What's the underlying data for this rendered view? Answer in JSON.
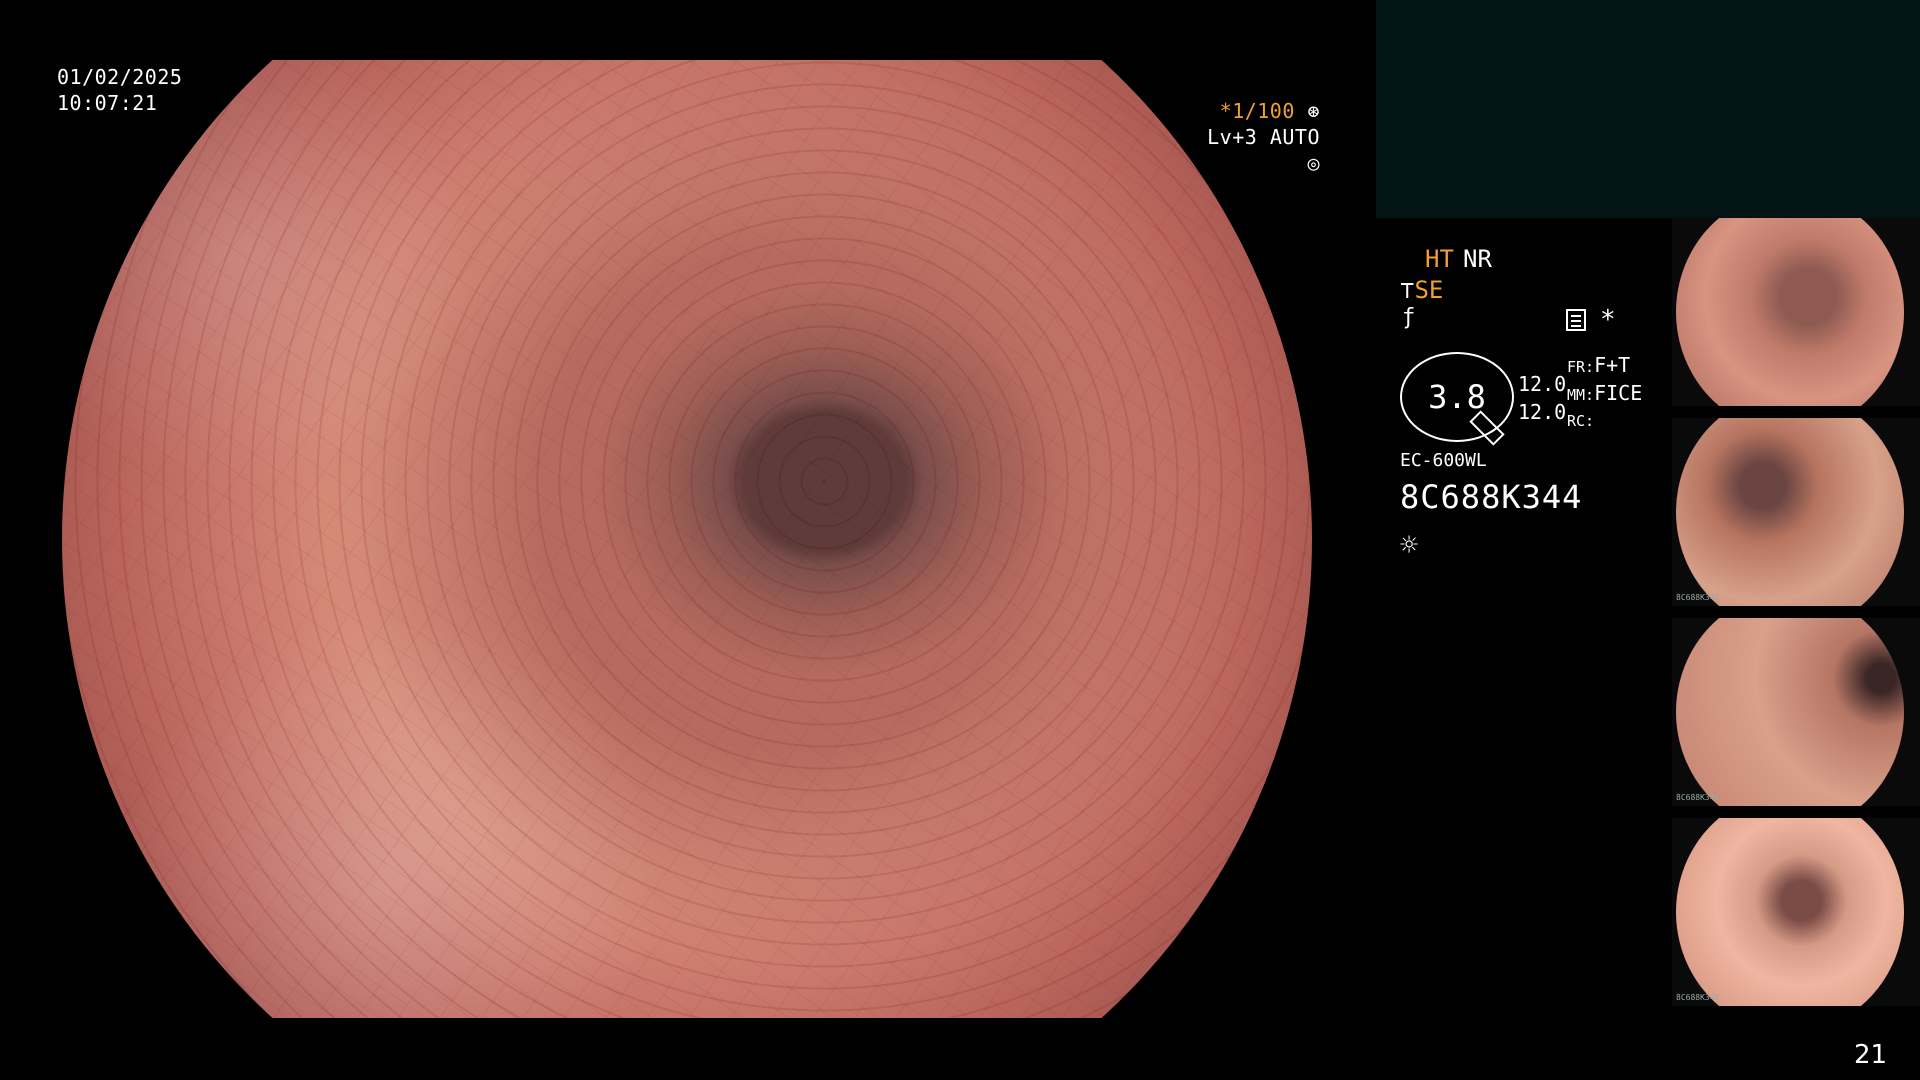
{
  "osd": {
    "date": "01/02/2025",
    "time": "10:07:21",
    "shutter_prefix": "*",
    "shutter": "1/100",
    "level": "Lv+3 AUTO"
  },
  "panel": {
    "ht": "HT",
    "nr": "NR",
    "se": "SE",
    "zoom_value": "3.8",
    "num1": "12.0",
    "num2": "12.0",
    "fr_label": "FR:",
    "fr_value": "F+T",
    "mm_label": "MM:",
    "mm_value": "FICE",
    "rc_label": "RC:",
    "model": "EC-600WL",
    "serial": "8C688K344"
  },
  "thumbnails": [
    {
      "caption": "",
      "index": ""
    },
    {
      "caption": "8C688K344",
      "index": ""
    },
    {
      "caption": "8C688K344",
      "index": ""
    },
    {
      "caption": "8C688K344",
      "index": ""
    }
  ],
  "page_number": "21",
  "colors": {
    "osd_text": "#ffffff",
    "accent": "#f0a030",
    "panel_bg": "#031414"
  }
}
